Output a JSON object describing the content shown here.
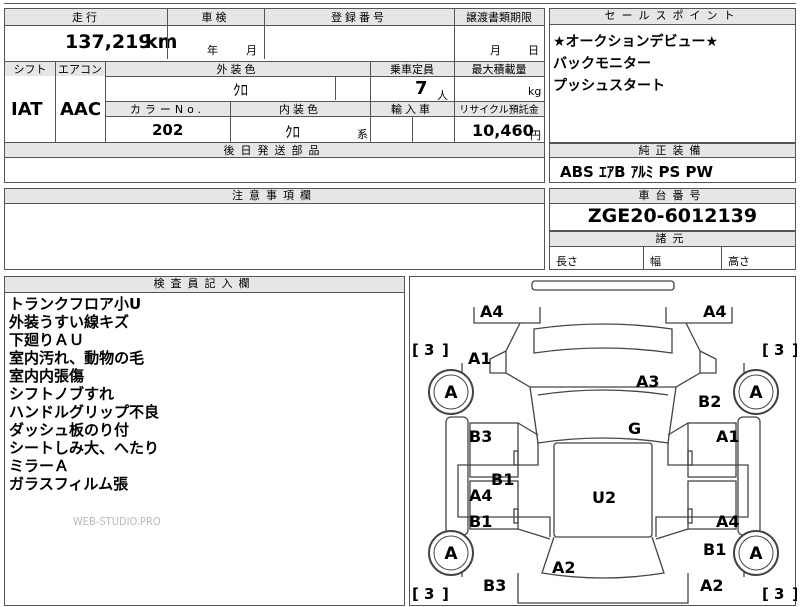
{
  "main_table": {
    "headers": {
      "mileage": "走行",
      "inspection": "車検",
      "registration_no": "登録番号",
      "transfer_deadline": "譲渡書類期限"
    },
    "mileage_value": "137,219",
    "mileage_unit": "km",
    "inspection_year_unit": "年",
    "inspection_month_unit": "月",
    "deadline_month_unit": "月",
    "deadline_day_unit": "日",
    "shift_label": "シフト",
    "aircon_label": "エアコン",
    "exterior_color_label": "外装色",
    "exterior_color_value": "ｸﾛ",
    "capacity_label": "乗車定員",
    "capacity_value": "7",
    "capacity_unit": "人",
    "max_load_label": "最大積載量",
    "max_load_unit": "kg",
    "shift_value": "IAT",
    "aircon_value": "AAC",
    "color_no_label": "カラーNo.",
    "interior_color_label": "内装色",
    "import_label": "輸入車",
    "recycle_label": "リサイクル預託金",
    "color_no_value": "202",
    "interior_color_value": "ｸﾛ",
    "interior_suffix": "系",
    "recycle_value": "10,460",
    "recycle_unit": "円",
    "later_parts_label": "後日発送部品"
  },
  "sales_points": {
    "header": "セールスポイント",
    "lines": [
      "★オークションデビュー★",
      "バックモニター",
      "プッシュスタート"
    ]
  },
  "standard_equipment": {
    "header": "純正装備",
    "value": "ABS ｴｱB ｱﾙﾐ PS PW"
  },
  "caution": {
    "header": "注意事項欄"
  },
  "chassis": {
    "header": "車台番号",
    "value": "ZGE20-6012139"
  },
  "dimensions": {
    "header": "諸元",
    "length": "長さ",
    "width": "幅",
    "height": "高さ"
  },
  "inspector": {
    "header": "検査員記入欄",
    "notes": [
      "トランクフロア小U",
      "外装うすい線キズ",
      "下廻りＡＵ",
      "室内汚れ、動物の毛",
      "室内内張傷",
      "シフトノブすれ",
      "ハンドルグリップ不良",
      "ダッシュ板のり付",
      "シートしみ大、へたり",
      "ミラーＡ",
      "ガラスフィルム張"
    ]
  },
  "watermark": "WEB-STUDIO.PRO",
  "diagram": {
    "tire_grade": "A",
    "tire_depth": "3",
    "marks": [
      "A4",
      "A4",
      "A1",
      "A3",
      "B2",
      "G",
      "B3",
      "A1",
      "B1",
      "A4",
      "U2",
      "B1",
      "A4",
      "B1",
      "A2",
      "B3",
      "A2"
    ]
  }
}
